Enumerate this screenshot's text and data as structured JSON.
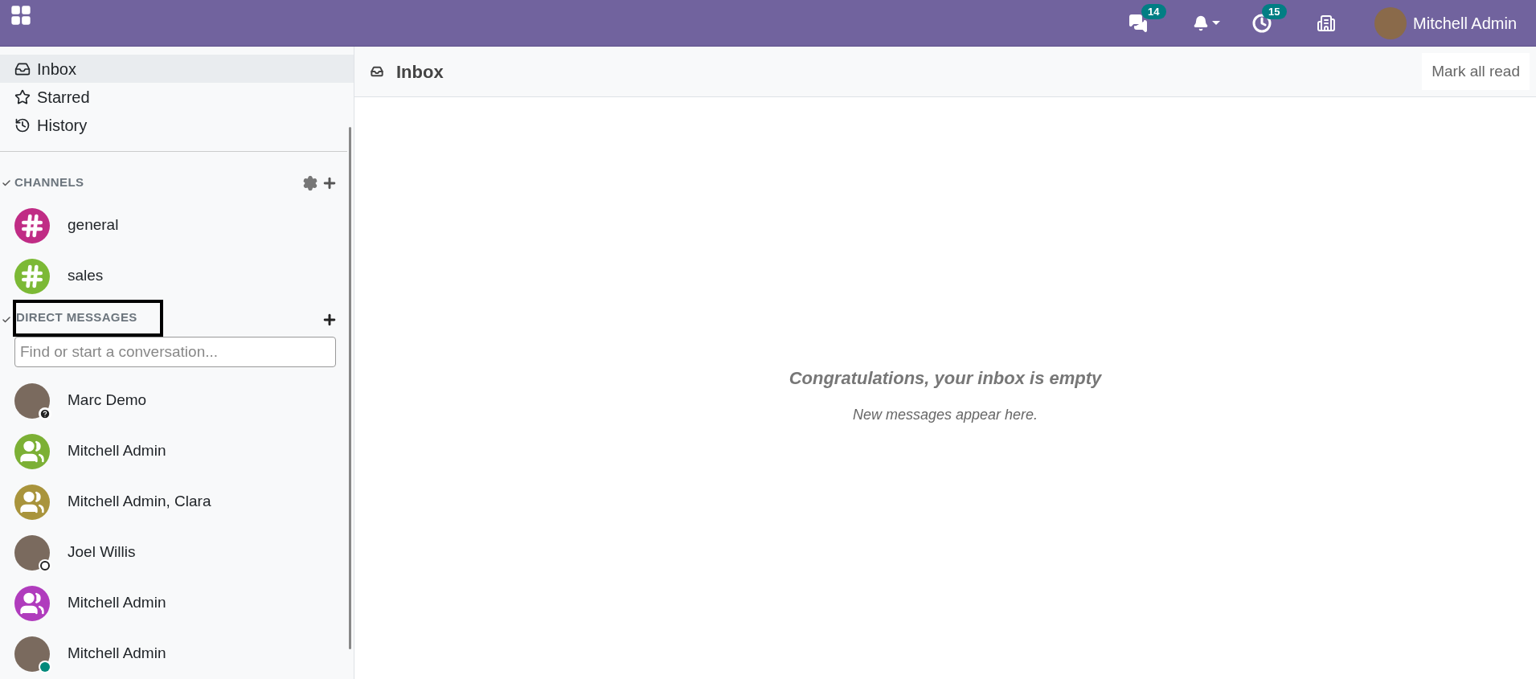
{
  "topbar": {
    "messages_badge": "14",
    "activities_badge": "15",
    "user_name": "Mitchell Admin"
  },
  "sidebar": {
    "mailboxes": [
      {
        "label": "Inbox",
        "selected": true
      },
      {
        "label": "Starred",
        "selected": false
      },
      {
        "label": "History",
        "selected": false
      }
    ],
    "channels": {
      "title": "CHANNELS",
      "expanded": true,
      "items": [
        {
          "name": "general",
          "color": "#c02c85"
        },
        {
          "name": "sales",
          "color": "#7cb935"
        }
      ]
    },
    "direct_messages": {
      "title": "DIRECT MESSAGES",
      "expanded": true,
      "highlighted": true,
      "search": {
        "placeholder": "Find or start a conversation..."
      },
      "items": [
        {
          "name": "Marc Demo",
          "kind": "unknown"
        },
        {
          "name": "Mitchell Admin",
          "kind": "group",
          "color": "#7cb035"
        },
        {
          "name": "Mitchell Admin, Clara",
          "kind": "group",
          "color": "#a9943c"
        },
        {
          "name": "Joel Willis",
          "kind": "offline"
        },
        {
          "name": "Mitchell Admin",
          "kind": "group",
          "color": "#b03cbd"
        },
        {
          "name": "Mitchell Admin",
          "kind": "online"
        }
      ]
    }
  },
  "main": {
    "title": "Inbox",
    "mark_all_read": "Mark all read",
    "empty_title": "Congratulations, your inbox is empty",
    "empty_hint": "New messages appear here."
  }
}
